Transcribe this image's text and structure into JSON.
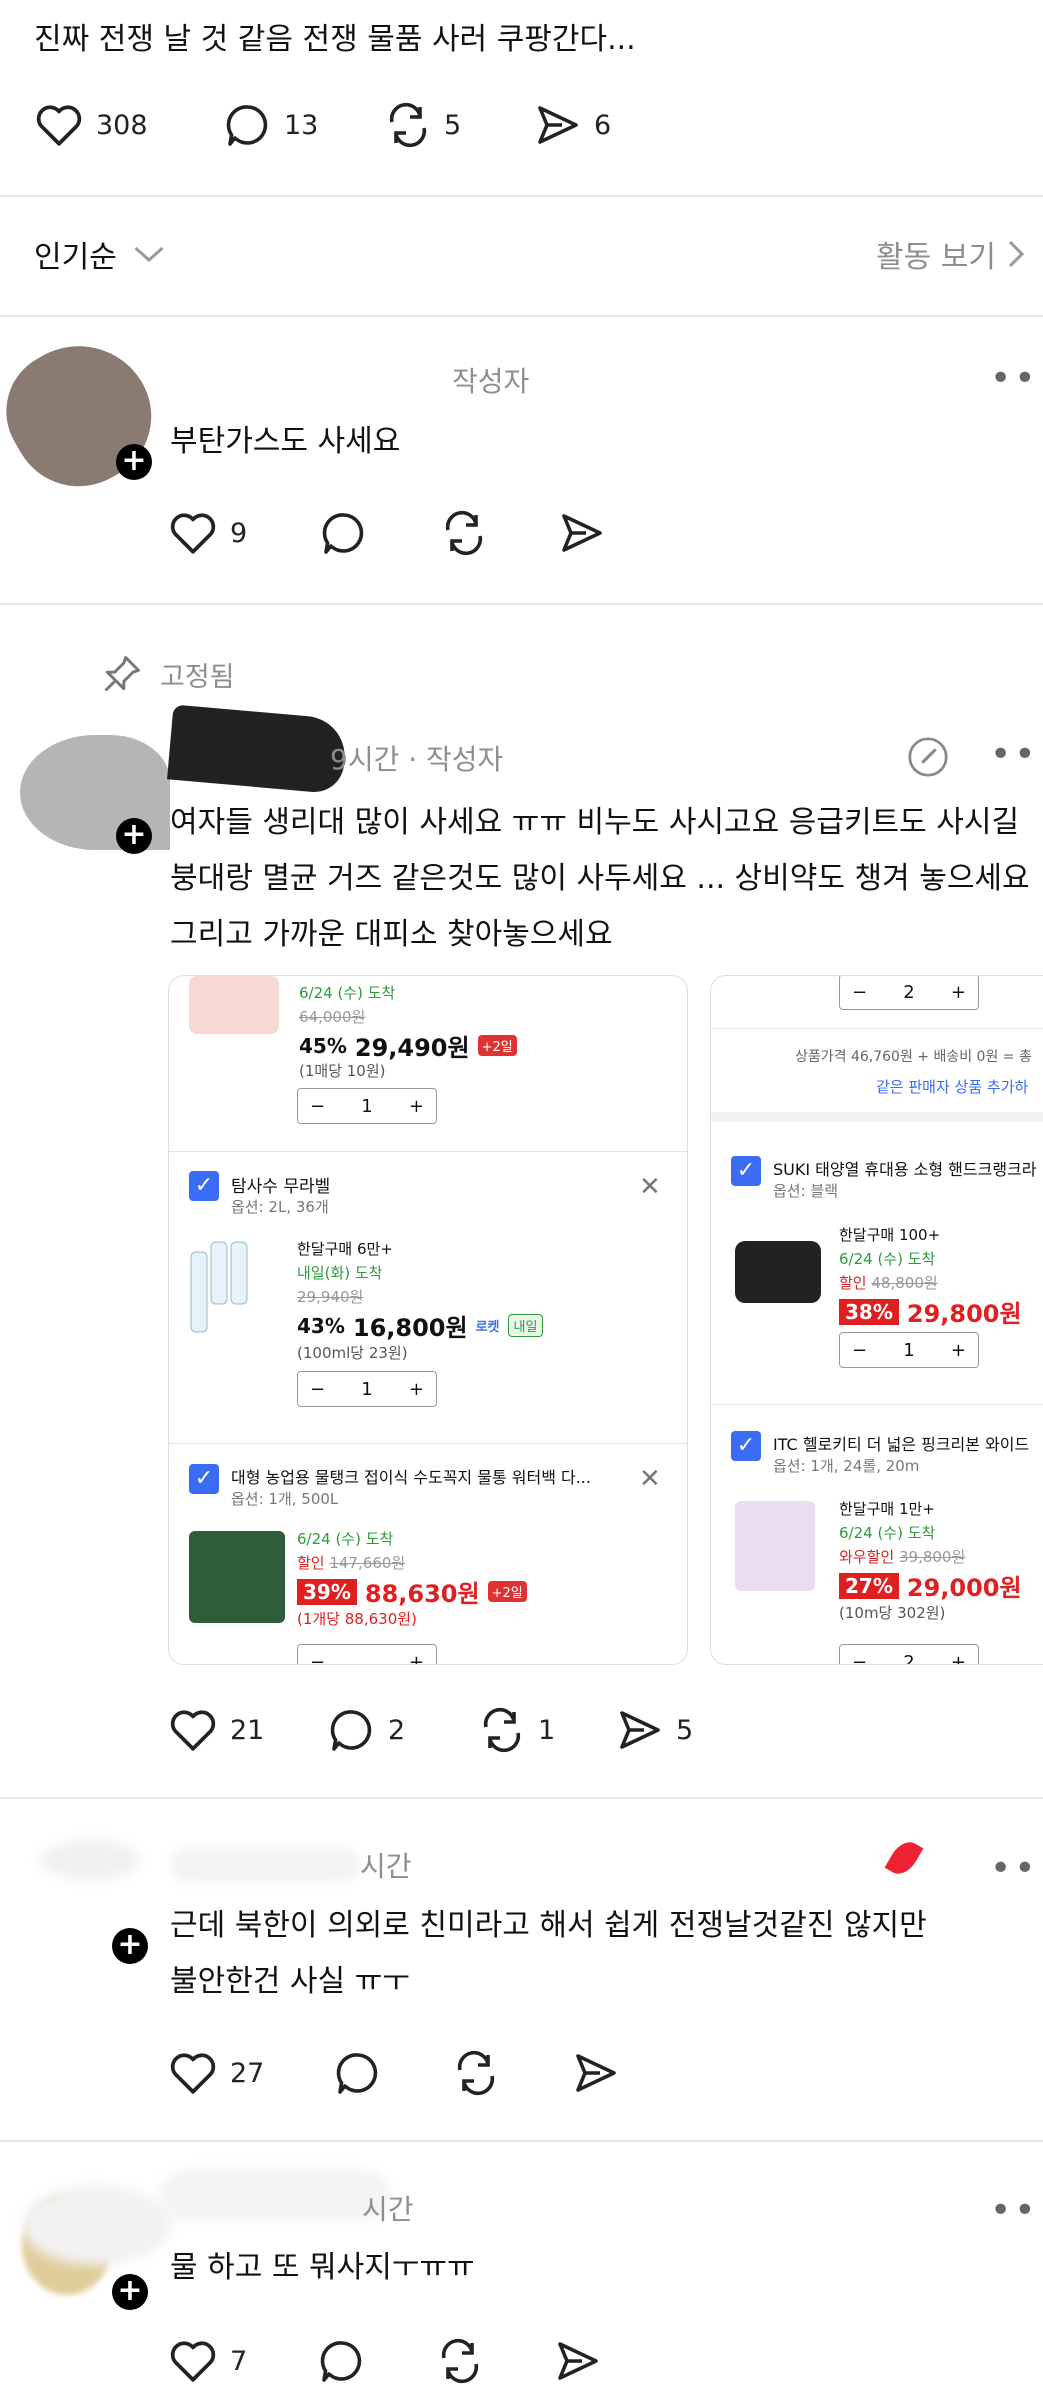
{
  "post": {
    "text": "진짜 전쟁 날 것 같음 전쟁 물품 사러 쿠팡간다...",
    "likes": "308",
    "comments": "13",
    "reposts": "5",
    "shares": "6"
  },
  "sort": {
    "label": "인기순",
    "activity_label": "활동 보기"
  },
  "comments": [
    {
      "tag": "작성자",
      "text": "부탄가스도 사세요",
      "likes": "9"
    },
    {
      "pinned_label": "고정됨",
      "meta": "9시간 · 작성자",
      "text_lines": [
        "여자들 생리대 많이 사세요 ㅠㅠ 비누도 사시고요 응급키트도 사시길",
        "붕대랑 멸균 거즈 같은것도 많이 사두세요 ... 상비약도 챙겨 놓으세요",
        "그리고 가까운 대피소 찾아놓으세요"
      ],
      "likes": "21",
      "comments": "2",
      "reposts": "1",
      "shares": "5"
    },
    {
      "meta": "시간",
      "text_lines": [
        "근데 북한이 의외로 친미라고 해서 쉽게 전쟁날것같진 않지만",
        "불안한건 사실 ㅠㅜ"
      ],
      "likes": "27"
    },
    {
      "meta": "시간",
      "text": "물 하고 또 뭐사지ㅜㅠㅠ",
      "likes": "7"
    }
  ],
  "cart_left": {
    "item1": {
      "arrival": "6/24 (수) 도착",
      "old_price": "64,000원",
      "discount": "45%",
      "price": "29,490원",
      "badge": "+2일",
      "unit": "(1매당 10원)",
      "qty": "1"
    },
    "item2": {
      "name": "탐사수 무라벨",
      "option": "옵션: 2L, 36개",
      "monthly": "한달구매 6만+",
      "arrival": "내일(화) 도착",
      "old_price": "29,940원",
      "discount": "43%",
      "price": "16,800원",
      "rocket": "로켓",
      "tomorrow": "내일",
      "unit": "(100ml당 23원)",
      "qty": "1"
    },
    "item3": {
      "name": "대형 농업용 물탱크 접이식 수도꼭지 물통 워터백 다...",
      "option": "옵션: 1개, 500L",
      "arrival": "6/24 (수) 도착",
      "sale": "할인",
      "old_price": "147,660원",
      "discount": "39%",
      "price": "88,630원",
      "badge": "+2일",
      "unit": "(1개당 88,630원)"
    }
  },
  "cart_right": {
    "qty_top": "2",
    "summary": "상품가격  46,760원 + 배송비  0원 = 총",
    "link": "같은 판매자 상품 추가하",
    "item1": {
      "name": "SUKI 태양열 휴대용 소형 핸드크랭크라",
      "option": "옵션: 블랙",
      "monthly": "한달구매 100+",
      "arrival": "6/24 (수) 도착",
      "sale": "할인",
      "old_price": "48,800원",
      "discount": "38%",
      "price": "29,800원",
      "qty": "1"
    },
    "item2": {
      "name": "ITC 헬로키티 더 넓은 핑크리본 와이드",
      "option": "옵션: 1개, 24롤, 20m",
      "monthly": "한달구매 1만+",
      "arrival": "6/24 (수) 도착",
      "sale": "와우할인",
      "old_price": "39,800원",
      "discount": "27%",
      "price": "29,000원",
      "unit": "(10m당 302원)",
      "qty": "2"
    }
  }
}
